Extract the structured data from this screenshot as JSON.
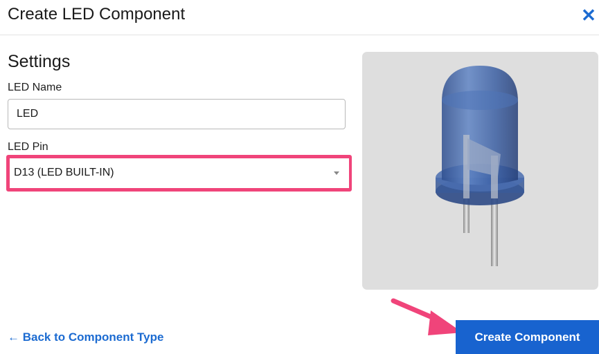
{
  "dialog": {
    "title": "Create LED Component",
    "close_icon": "close-icon",
    "close_glyph": "✕"
  },
  "settings": {
    "heading": "Settings",
    "led_name_label": "LED Name",
    "led_name_value": "LED",
    "led_pin_label": "LED Pin",
    "led_pin_selected": "D13 (LED BUILT-IN)"
  },
  "preview": {
    "image": "led-image"
  },
  "footer": {
    "back_label": "← Back to Component Type",
    "create_label": "Create Component"
  },
  "colors": {
    "accent": "#1863cf",
    "link": "#1c6bd1",
    "highlight": "#f0447a",
    "annotation_arrow": "#f0447a"
  }
}
